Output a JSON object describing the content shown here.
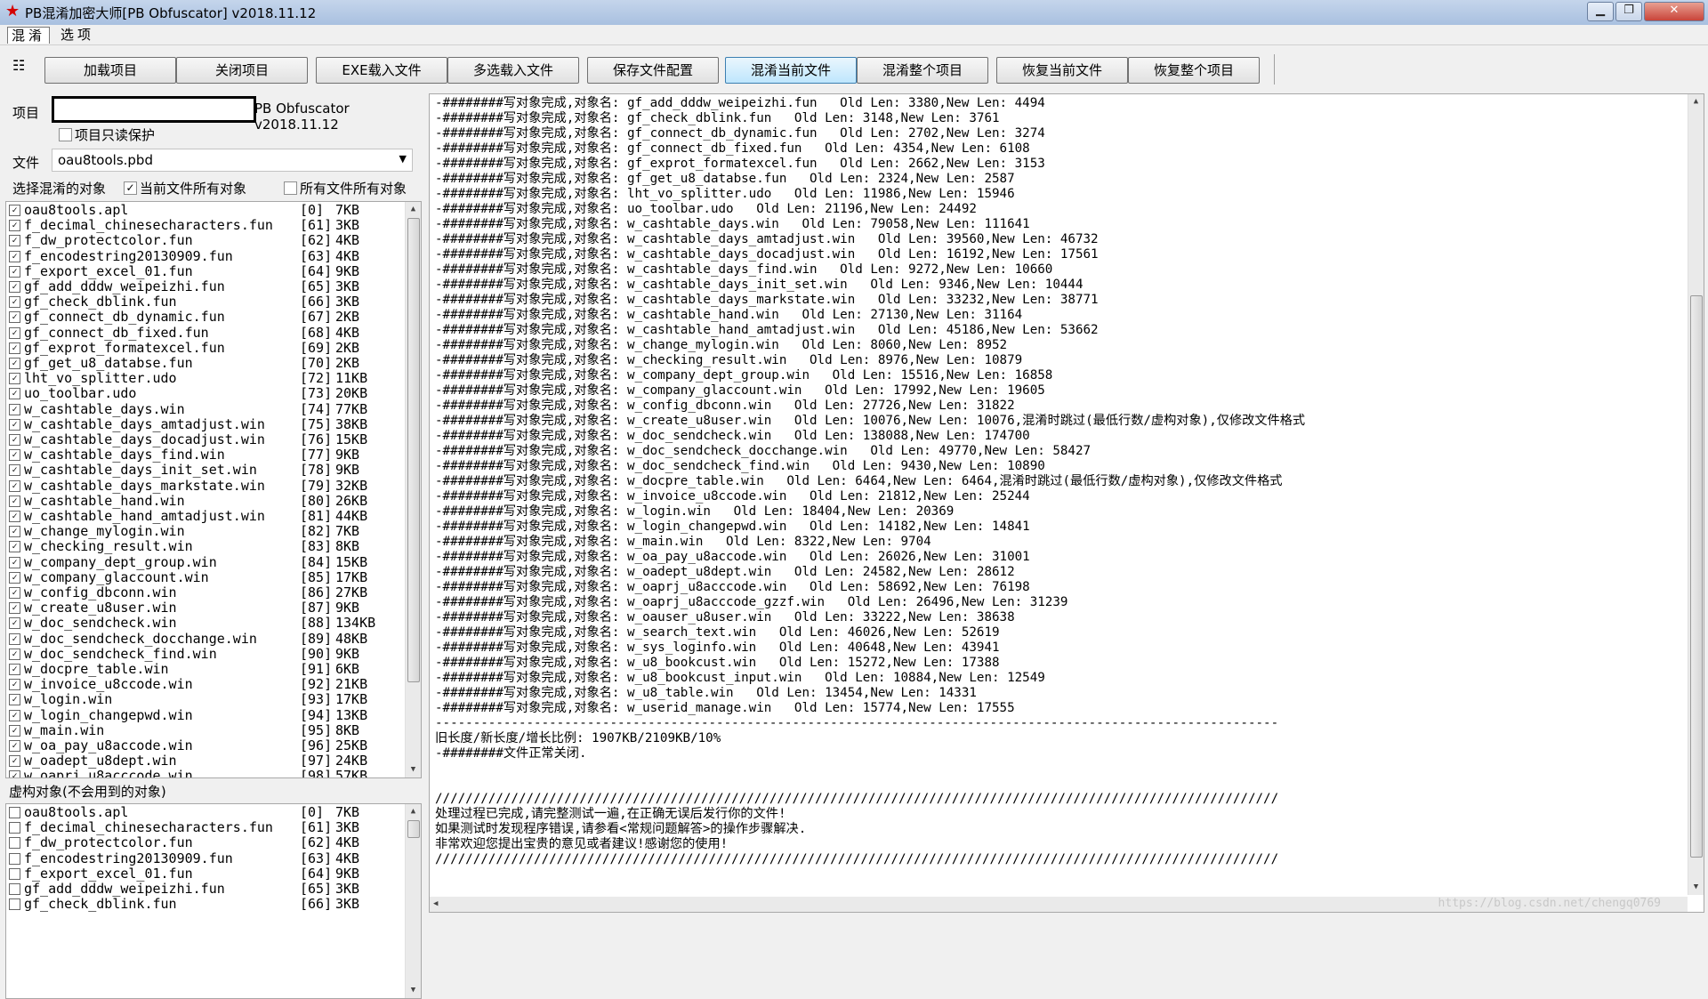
{
  "window": {
    "title": "PB混淆加密大师[PB Obfuscator] v2018.11.12",
    "min_glyph": "▁",
    "max_glyph": "❐",
    "close_glyph": "✕",
    "app_icon": "red-star-icon"
  },
  "menu": {
    "obfuscate": "混淆",
    "options": "选项"
  },
  "toolbar": {
    "icon": "project-icon",
    "load_project": "加载项目",
    "close_project": "关闭项目",
    "exe_load_file": "EXE载入文件",
    "multi_load_files": "多选载入文件",
    "save_file_config": "保存文件配置",
    "obfuscate_current_file": "混淆当前文件",
    "obfuscate_whole_project": "混淆整个项目",
    "restore_current_file": "恢复当前文件",
    "restore_whole_project": "恢复整个项目"
  },
  "left": {
    "project_label": "项目",
    "project_value": "",
    "project_version": "PB Obfuscator v2018.11.12",
    "readonly_label": "项目只读保护",
    "readonly_checked": false,
    "file_label": "文件",
    "file_value": "oau8tools.pbd",
    "choose_label": "选择混淆的对象",
    "current_all_label": "当前文件所有对象",
    "current_all_checked": true,
    "all_files_label": "所有文件所有对象",
    "all_files_checked": false,
    "virtual_label": "虚构对象(不会用到的对象)"
  },
  "objects": [
    {
      "name": "oau8tools.apl",
      "idx": "[0]",
      "size": "7KB"
    },
    {
      "name": "f_decimal_chinesecharacters.fun",
      "idx": "[61]",
      "size": "3KB"
    },
    {
      "name": "f_dw_protectcolor.fun",
      "idx": "[62]",
      "size": "4KB"
    },
    {
      "name": "f_encodestring20130909.fun",
      "idx": "[63]",
      "size": "4KB"
    },
    {
      "name": "f_export_excel_01.fun",
      "idx": "[64]",
      "size": "9KB"
    },
    {
      "name": "gf_add_dddw_weipeizhi.fun",
      "idx": "[65]",
      "size": "3KB"
    },
    {
      "name": "gf_check_dblink.fun",
      "idx": "[66]",
      "size": "3KB"
    },
    {
      "name": "gf_connect_db_dynamic.fun",
      "idx": "[67]",
      "size": "2KB"
    },
    {
      "name": "gf_connect_db_fixed.fun",
      "idx": "[68]",
      "size": "4KB"
    },
    {
      "name": "gf_exprot_formatexcel.fun",
      "idx": "[69]",
      "size": "2KB"
    },
    {
      "name": "gf_get_u8_databse.fun",
      "idx": "[70]",
      "size": "2KB"
    },
    {
      "name": "lht_vo_splitter.udo",
      "idx": "[72]",
      "size": "11KB"
    },
    {
      "name": "uo_toolbar.udo",
      "idx": "[73]",
      "size": "20KB"
    },
    {
      "name": "w_cashtable_days.win",
      "idx": "[74]",
      "size": "77KB"
    },
    {
      "name": "w_cashtable_days_amtadjust.win",
      "idx": "[75]",
      "size": "38KB"
    },
    {
      "name": "w_cashtable_days_docadjust.win",
      "idx": "[76]",
      "size": "15KB"
    },
    {
      "name": "w_cashtable_days_find.win",
      "idx": "[77]",
      "size": "9KB"
    },
    {
      "name": "w_cashtable_days_init_set.win",
      "idx": "[78]",
      "size": "9KB"
    },
    {
      "name": "w_cashtable_days_markstate.win",
      "idx": "[79]",
      "size": "32KB"
    },
    {
      "name": "w_cashtable_hand.win",
      "idx": "[80]",
      "size": "26KB"
    },
    {
      "name": "w_cashtable_hand_amtadjust.win",
      "idx": "[81]",
      "size": "44KB"
    },
    {
      "name": "w_change_mylogin.win",
      "idx": "[82]",
      "size": "7KB"
    },
    {
      "name": "w_checking_result.win",
      "idx": "[83]",
      "size": "8KB"
    },
    {
      "name": "w_company_dept_group.win",
      "idx": "[84]",
      "size": "15KB"
    },
    {
      "name": "w_company_glaccount.win",
      "idx": "[85]",
      "size": "17KB"
    },
    {
      "name": "w_config_dbconn.win",
      "idx": "[86]",
      "size": "27KB"
    },
    {
      "name": "w_create_u8user.win",
      "idx": "[87]",
      "size": "9KB"
    },
    {
      "name": "w_doc_sendcheck.win",
      "idx": "[88]",
      "size": "134KB"
    },
    {
      "name": "w_doc_sendcheck_docchange.win",
      "idx": "[89]",
      "size": "48KB"
    },
    {
      "name": "w_doc_sendcheck_find.win",
      "idx": "[90]",
      "size": "9KB"
    },
    {
      "name": "w_docpre_table.win",
      "idx": "[91]",
      "size": "6KB"
    },
    {
      "name": "w_invoice_u8ccode.win",
      "idx": "[92]",
      "size": "21KB"
    },
    {
      "name": "w_login.win",
      "idx": "[93]",
      "size": "17KB"
    },
    {
      "name": "w_login_changepwd.win",
      "idx": "[94]",
      "size": "13KB"
    },
    {
      "name": "w_main.win",
      "idx": "[95]",
      "size": "8KB"
    },
    {
      "name": "w_oa_pay_u8accode.win",
      "idx": "[96]",
      "size": "25KB"
    },
    {
      "name": "w_oadept_u8dept.win",
      "idx": "[97]",
      "size": "24KB"
    },
    {
      "name": "w_oaprj_u8acccode.win",
      "idx": "[98]",
      "size": "57KB"
    }
  ],
  "virtual_objects": [
    {
      "name": "oau8tools.apl",
      "idx": "[0]",
      "size": "7KB"
    },
    {
      "name": "f_decimal_chinesecharacters.fun",
      "idx": "[61]",
      "size": "3KB"
    },
    {
      "name": "f_dw_protectcolor.fun",
      "idx": "[62]",
      "size": "4KB"
    },
    {
      "name": "f_encodestring20130909.fun",
      "idx": "[63]",
      "size": "4KB"
    },
    {
      "name": "f_export_excel_01.fun",
      "idx": "[64]",
      "size": "9KB"
    },
    {
      "name": "gf_add_dddw_weipeizhi.fun",
      "idx": "[65]",
      "size": "3KB"
    },
    {
      "name": "gf_check_dblink.fun",
      "idx": "[66]",
      "size": "3KB"
    }
  ],
  "log": [
    "-########写对象完成,对象名: gf_add_dddw_weipeizhi.fun   Old Len: 3380,New Len: 4494",
    "-########写对象完成,对象名: gf_check_dblink.fun   Old Len: 3148,New Len: 3761",
    "-########写对象完成,对象名: gf_connect_db_dynamic.fun   Old Len: 2702,New Len: 3274",
    "-########写对象完成,对象名: gf_connect_db_fixed.fun   Old Len: 4354,New Len: 6108",
    "-########写对象完成,对象名: gf_exprot_formatexcel.fun   Old Len: 2662,New Len: 3153",
    "-########写对象完成,对象名: gf_get_u8_databse.fun   Old Len: 2324,New Len: 2587",
    "-########写对象完成,对象名: lht_vo_splitter.udo   Old Len: 11986,New Len: 15946",
    "-########写对象完成,对象名: uo_toolbar.udo   Old Len: 21196,New Len: 24492",
    "-########写对象完成,对象名: w_cashtable_days.win   Old Len: 79058,New Len: 111641",
    "-########写对象完成,对象名: w_cashtable_days_amtadjust.win   Old Len: 39560,New Len: 46732",
    "-########写对象完成,对象名: w_cashtable_days_docadjust.win   Old Len: 16192,New Len: 17561",
    "-########写对象完成,对象名: w_cashtable_days_find.win   Old Len: 9272,New Len: 10660",
    "-########写对象完成,对象名: w_cashtable_days_init_set.win   Old Len: 9346,New Len: 10444",
    "-########写对象完成,对象名: w_cashtable_days_markstate.win   Old Len: 33232,New Len: 38771",
    "-########写对象完成,对象名: w_cashtable_hand.win   Old Len: 27130,New Len: 31164",
    "-########写对象完成,对象名: w_cashtable_hand_amtadjust.win   Old Len: 45186,New Len: 53662",
    "-########写对象完成,对象名: w_change_mylogin.win   Old Len: 8060,New Len: 8952",
    "-########写对象完成,对象名: w_checking_result.win   Old Len: 8976,New Len: 10879",
    "-########写对象完成,对象名: w_company_dept_group.win   Old Len: 15516,New Len: 16858",
    "-########写对象完成,对象名: w_company_glaccount.win   Old Len: 17992,New Len: 19605",
    "-########写对象完成,对象名: w_config_dbconn.win   Old Len: 27726,New Len: 31822",
    "-########写对象完成,对象名: w_create_u8user.win   Old Len: 10076,New Len: 10076,混淆时跳过(最低行数/虚构对象),仅修改文件格式",
    "-########写对象完成,对象名: w_doc_sendcheck.win   Old Len: 138088,New Len: 174700",
    "-########写对象完成,对象名: w_doc_sendcheck_docchange.win   Old Len: 49770,New Len: 58427",
    "-########写对象完成,对象名: w_doc_sendcheck_find.win   Old Len: 9430,New Len: 10890",
    "-########写对象完成,对象名: w_docpre_table.win   Old Len: 6464,New Len: 6464,混淆时跳过(最低行数/虚构对象),仅修改文件格式",
    "-########写对象完成,对象名: w_invoice_u8ccode.win   Old Len: 21812,New Len: 25244",
    "-########写对象完成,对象名: w_login.win   Old Len: 18404,New Len: 20369",
    "-########写对象完成,对象名: w_login_changepwd.win   Old Len: 14182,New Len: 14841",
    "-########写对象完成,对象名: w_main.win   Old Len: 8322,New Len: 9704",
    "-########写对象完成,对象名: w_oa_pay_u8accode.win   Old Len: 26026,New Len: 31001",
    "-########写对象完成,对象名: w_oadept_u8dept.win   Old Len: 24582,New Len: 28612",
    "-########写对象完成,对象名: w_oaprj_u8acccode.win   Old Len: 58692,New Len: 76198",
    "-########写对象完成,对象名: w_oaprj_u8acccode_gzzf.win   Old Len: 26496,New Len: 31239",
    "-########写对象完成,对象名: w_oauser_u8user.win   Old Len: 33222,New Len: 38638",
    "-########写对象完成,对象名: w_search_text.win   Old Len: 46026,New Len: 52619",
    "-########写对象完成,对象名: w_sys_loginfo.win   Old Len: 40648,New Len: 43941",
    "-########写对象完成,对象名: w_u8_bookcust.win   Old Len: 15272,New Len: 17388",
    "-########写对象完成,对象名: w_u8_bookcust_input.win   Old Len: 10884,New Len: 12549",
    "-########写对象完成,对象名: w_u8_table.win   Old Len: 13454,New Len: 14331",
    "-########写对象完成,对象名: w_userid_manage.win   Old Len: 15774,New Len: 17555",
    "---------------------------------------------------------------------------------------------------------------",
    "旧长度/新长度/增长比例: 1907KB/2109KB/10%",
    "-########文件正常关闭.",
    "",
    "",
    "///////////////////////////////////////////////////////////////////////////////////////////////////////////////",
    "处理过程已完成,请完整测试一遍,在正确无误后发行你的文件!",
    "如果测试时发现程序错误,请参看<常规问题解答>的操作步骤解决.",
    "非常欢迎您提出宝贵的意见或者建议!感谢您的使用!",
    "///////////////////////////////////////////////////////////////////////////////////////////////////////////////"
  ],
  "watermark": "https://blog.csdn.net/chengq0769"
}
